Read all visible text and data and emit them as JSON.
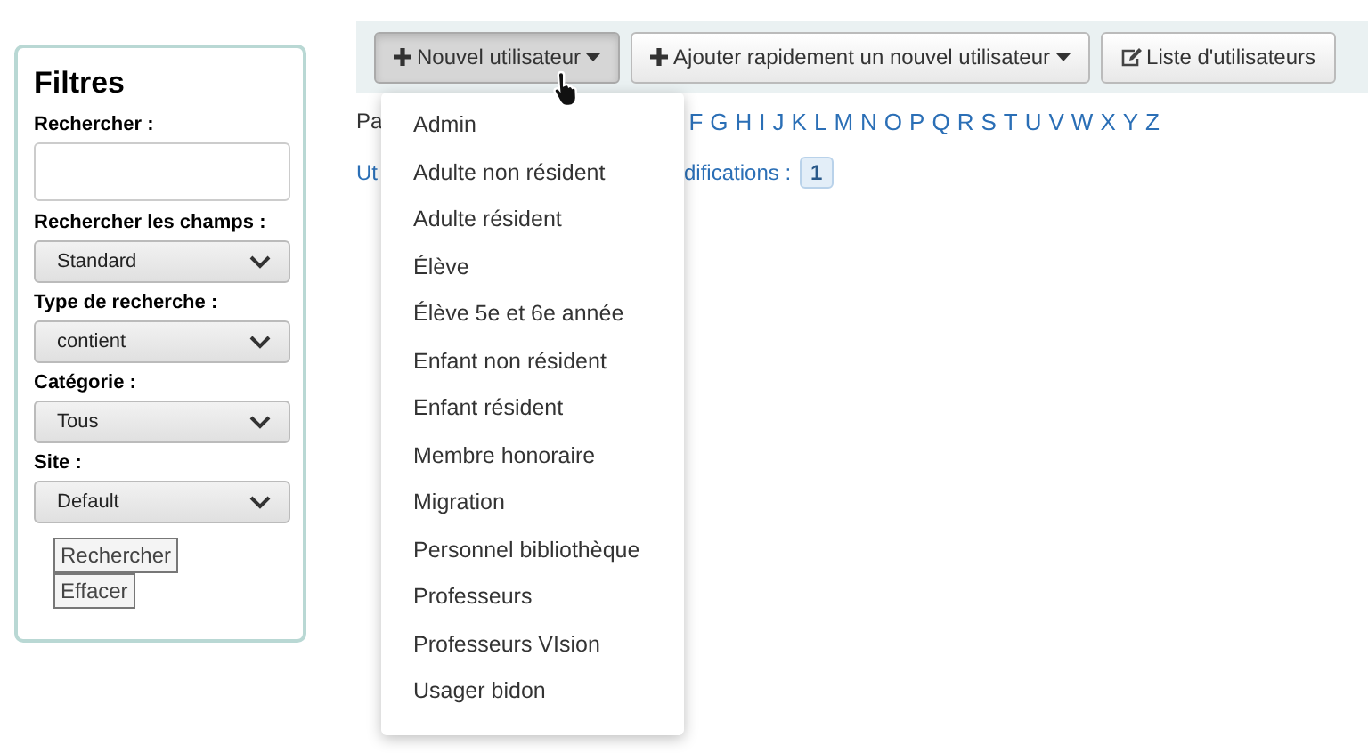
{
  "filters": {
    "title": "Filtres",
    "search": {
      "label": "Rechercher :"
    },
    "selects": [
      {
        "label": "Rechercher les champs :",
        "value": "Standard"
      },
      {
        "label": "Type de recherche :",
        "value": "contient"
      },
      {
        "label": "Catégorie :",
        "value": "Tous"
      },
      {
        "label": "Site :",
        "value": "Default"
      }
    ],
    "buttons": [
      "Rechercher",
      "Effacer"
    ]
  },
  "toolbar": {
    "buttons": [
      {
        "label": "Nouvel utilisateur",
        "kind": "add",
        "caret": true,
        "pressed": true
      },
      {
        "label": "Ajouter rapidement un nouvel utilisateur",
        "kind": "add",
        "caret": true,
        "pressed": false
      },
      {
        "label": "Liste d'utilisateurs",
        "kind": "list",
        "caret": false,
        "pressed": false
      }
    ]
  },
  "browse": {
    "prefix": "Pa",
    "letters": [
      "F",
      "G",
      "H",
      "I",
      "J",
      "K",
      "L",
      "M",
      "N",
      "O",
      "P",
      "Q",
      "R",
      "S",
      "T",
      "U",
      "V",
      "W",
      "X",
      "Y",
      "Z"
    ]
  },
  "modifications": {
    "prefix": "Ut",
    "label": "difications :",
    "count": "1"
  },
  "menu": {
    "items": [
      "Admin",
      "Adulte non résident",
      "Adulte résident",
      "Élève",
      "Élève 5e et 6e année",
      "Enfant non résident",
      "Enfant résident",
      "Membre honoraire",
      "Migration",
      "Personnel bibliothèque",
      "Professeurs",
      "Professeurs VIsion",
      "Usager bidon"
    ]
  }
}
